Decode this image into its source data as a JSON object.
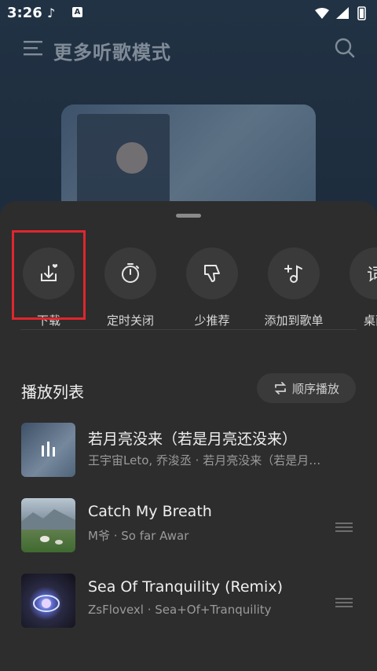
{
  "status_bar": {
    "time": "3:26"
  },
  "header": {
    "title": "更多听歌模式"
  },
  "actions": [
    {
      "label": "下载",
      "icon": "download-heart-icon"
    },
    {
      "label": "定时关闭",
      "icon": "timer-icon"
    },
    {
      "label": "少推荐",
      "icon": "thumbs-down-icon"
    },
    {
      "label": "添加到歌单",
      "icon": "add-to-playlist-icon"
    },
    {
      "label": "桌面",
      "icon": "desktop-lyrics-icon"
    }
  ],
  "playlist": {
    "title": "播放列表",
    "order_label": "顺序播放",
    "tracks": [
      {
        "title": "若月亮没来（若是月亮还没来）",
        "subtitle": "王宇宙Leto, 乔浚丞 · 若月亮没来（若是月…",
        "playing": true
      },
      {
        "title": "Catch My Breath",
        "subtitle": "M爷 · So far Awar",
        "playing": false
      },
      {
        "title": "Sea Of Tranquility (Remix)",
        "subtitle": "ZsFlovexl · Sea+Of+Tranquility",
        "playing": false
      }
    ]
  },
  "colors": {
    "highlight": "#e0262e",
    "sheet": "#2d2d2d"
  }
}
